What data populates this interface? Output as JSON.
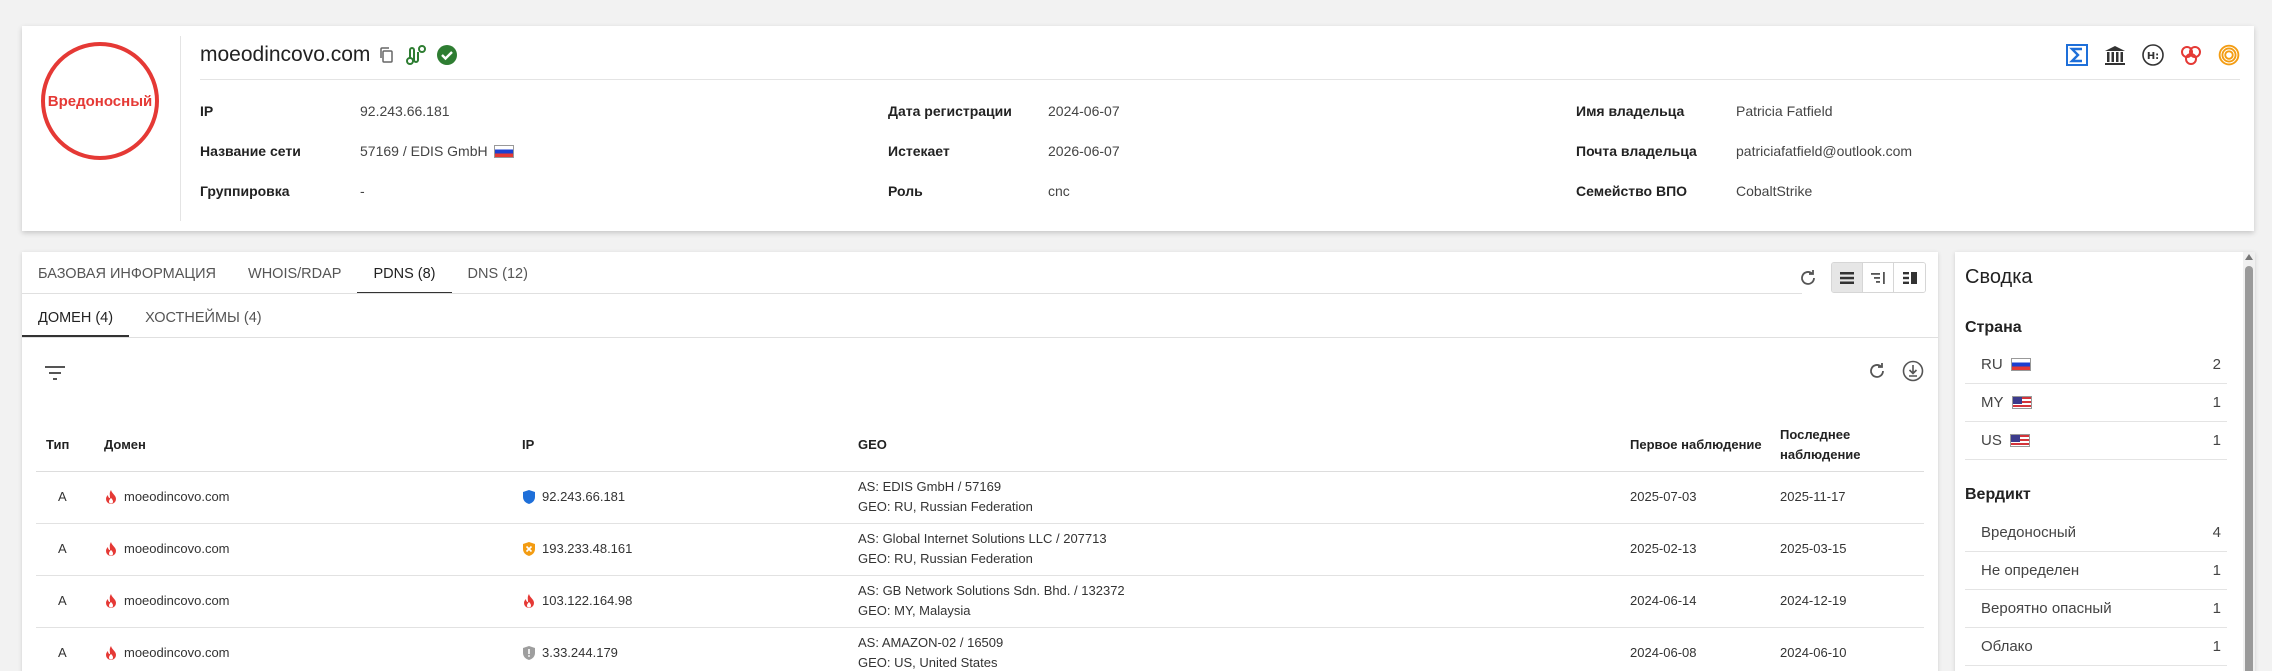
{
  "header": {
    "verdict": "Вредоносный",
    "domain": "moeodincovo.com",
    "fields": {
      "ip_label": "IP",
      "ip_value": "92.243.66.181",
      "network_label": "Название сети",
      "network_value": "57169 / EDIS GmbH",
      "group_label": "Группировка",
      "group_value": "-",
      "reg_label": "Дата регистрации",
      "reg_value": "2024-06-07",
      "exp_label": "Истекает",
      "exp_value": "2026-06-07",
      "role_label": "Роль",
      "role_value": "cnc",
      "owner_label": "Имя владельца",
      "owner_value": "Patricia Fatfield",
      "email_label": "Почта владельца",
      "email_value": "patriciafatfield@outlook.com",
      "family_label": "Семейство ВПО",
      "family_value": "CobaltStrike"
    }
  },
  "tabs": [
    "БАЗОВАЯ ИНФОРМАЦИЯ",
    "WHOIS/RDAP",
    "PDNS (8)",
    "DNS (12)"
  ],
  "subtabs": [
    "ДОМЕН (4)",
    "ХОСТНЕЙМЫ (4)"
  ],
  "table": {
    "headers": {
      "type": "Тип",
      "domain": "Домен",
      "ip": "IP",
      "geo": "GEO",
      "first": "Первое наблюдение",
      "last": "Последнее наблюдение"
    },
    "rows": [
      {
        "type": "A",
        "domain": "moeodincovo.com",
        "ip": "92.243.66.181",
        "ip_icon": "shield-blue-icon",
        "geo_as": "AS: EDIS GmbH / 57169",
        "geo_geo": "GEO: RU, Russian Federation",
        "first": "2025-07-03",
        "last": "2025-11-17"
      },
      {
        "type": "A",
        "domain": "moeodincovo.com",
        "ip": "193.233.48.161",
        "ip_icon": "shield-orange-icon",
        "geo_as": "AS: Global Internet Solutions LLC / 207713",
        "geo_geo": "GEO: RU, Russian Federation",
        "first": "2025-02-13",
        "last": "2025-03-15"
      },
      {
        "type": "A",
        "domain": "moeodincovo.com",
        "ip": "103.122.164.98",
        "ip_icon": "flame-icon",
        "geo_as": "AS: GB Network Solutions Sdn. Bhd. / 132372",
        "geo_geo": "GEO: MY, Malaysia",
        "first": "2024-06-14",
        "last": "2024-12-19"
      },
      {
        "type": "A",
        "domain": "moeodincovo.com",
        "ip": "3.33.244.179",
        "ip_icon": "shield-gray-icon",
        "geo_as": "AS: AMAZON-02 / 16509",
        "geo_geo": "GEO: US, United States",
        "first": "2024-06-08",
        "last": "2024-06-10"
      }
    ]
  },
  "summary": {
    "title": "Сводка",
    "country_title": "Страна",
    "countries": [
      {
        "code": "RU",
        "count": "2",
        "flag": "ru"
      },
      {
        "code": "MY",
        "count": "1",
        "flag": "us"
      },
      {
        "code": "US",
        "count": "1",
        "flag": "us"
      }
    ],
    "verdict_title": "Вердикт",
    "verdicts": [
      {
        "label": "Вредоносный",
        "count": "4"
      },
      {
        "label": "Не определен",
        "count": "1"
      },
      {
        "label": "Вероятно опасный",
        "count": "1"
      },
      {
        "label": "Облако",
        "count": "1"
      }
    ]
  },
  "colors": {
    "malicious": "#e53935",
    "accent_blue": "#1e6fd9",
    "ok_green": "#2e7d32",
    "warn_orange": "#f39c12"
  }
}
